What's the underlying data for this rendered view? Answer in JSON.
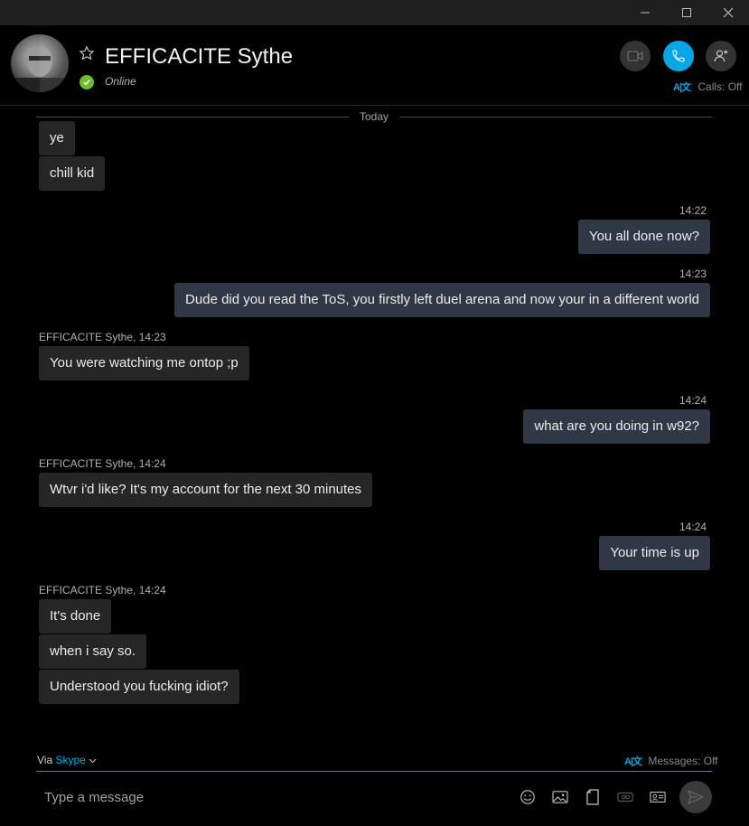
{
  "header": {
    "contact_name": "EFFICACITE Sythe",
    "status": "Online",
    "calls_label": "Calls: Off",
    "translate_glyph": "A|文"
  },
  "conversation": {
    "day_label": "Today",
    "incoming_1": [
      "ye",
      "chill kid"
    ],
    "out_1_time": "14:22",
    "out_1": "You all done now?",
    "out_2_time": "14:23",
    "out_2": "Dude did you read the ToS, you firstly left duel arena and now your in a different world",
    "in_2_meta": "EFFICACITE Sythe, 14:23",
    "in_2": "You were watching me ontop ;p",
    "out_3_time": "14:24",
    "out_3": "what are you doing in w92?",
    "in_3_meta": "EFFICACITE Sythe, 14:24",
    "in_3": "Wtvr i'd like? It's my account for the next 30 minutes",
    "out_4_time": "14:24",
    "out_4": "Your time is up",
    "in_4_meta": "EFFICACITE Sythe, 14:24",
    "in_4": [
      "It's done",
      "when i say so.",
      "Understood you fucking idiot?"
    ]
  },
  "composer": {
    "via_prefix": "Via",
    "via_service": "Skype",
    "messages_translate": "Messages: Off",
    "placeholder": "Type a message"
  },
  "colors": {
    "accent": "#00a8e8",
    "online": "#6cbf2a",
    "outgoing_bubble": "#303846",
    "incoming_bubble": "#262626"
  }
}
